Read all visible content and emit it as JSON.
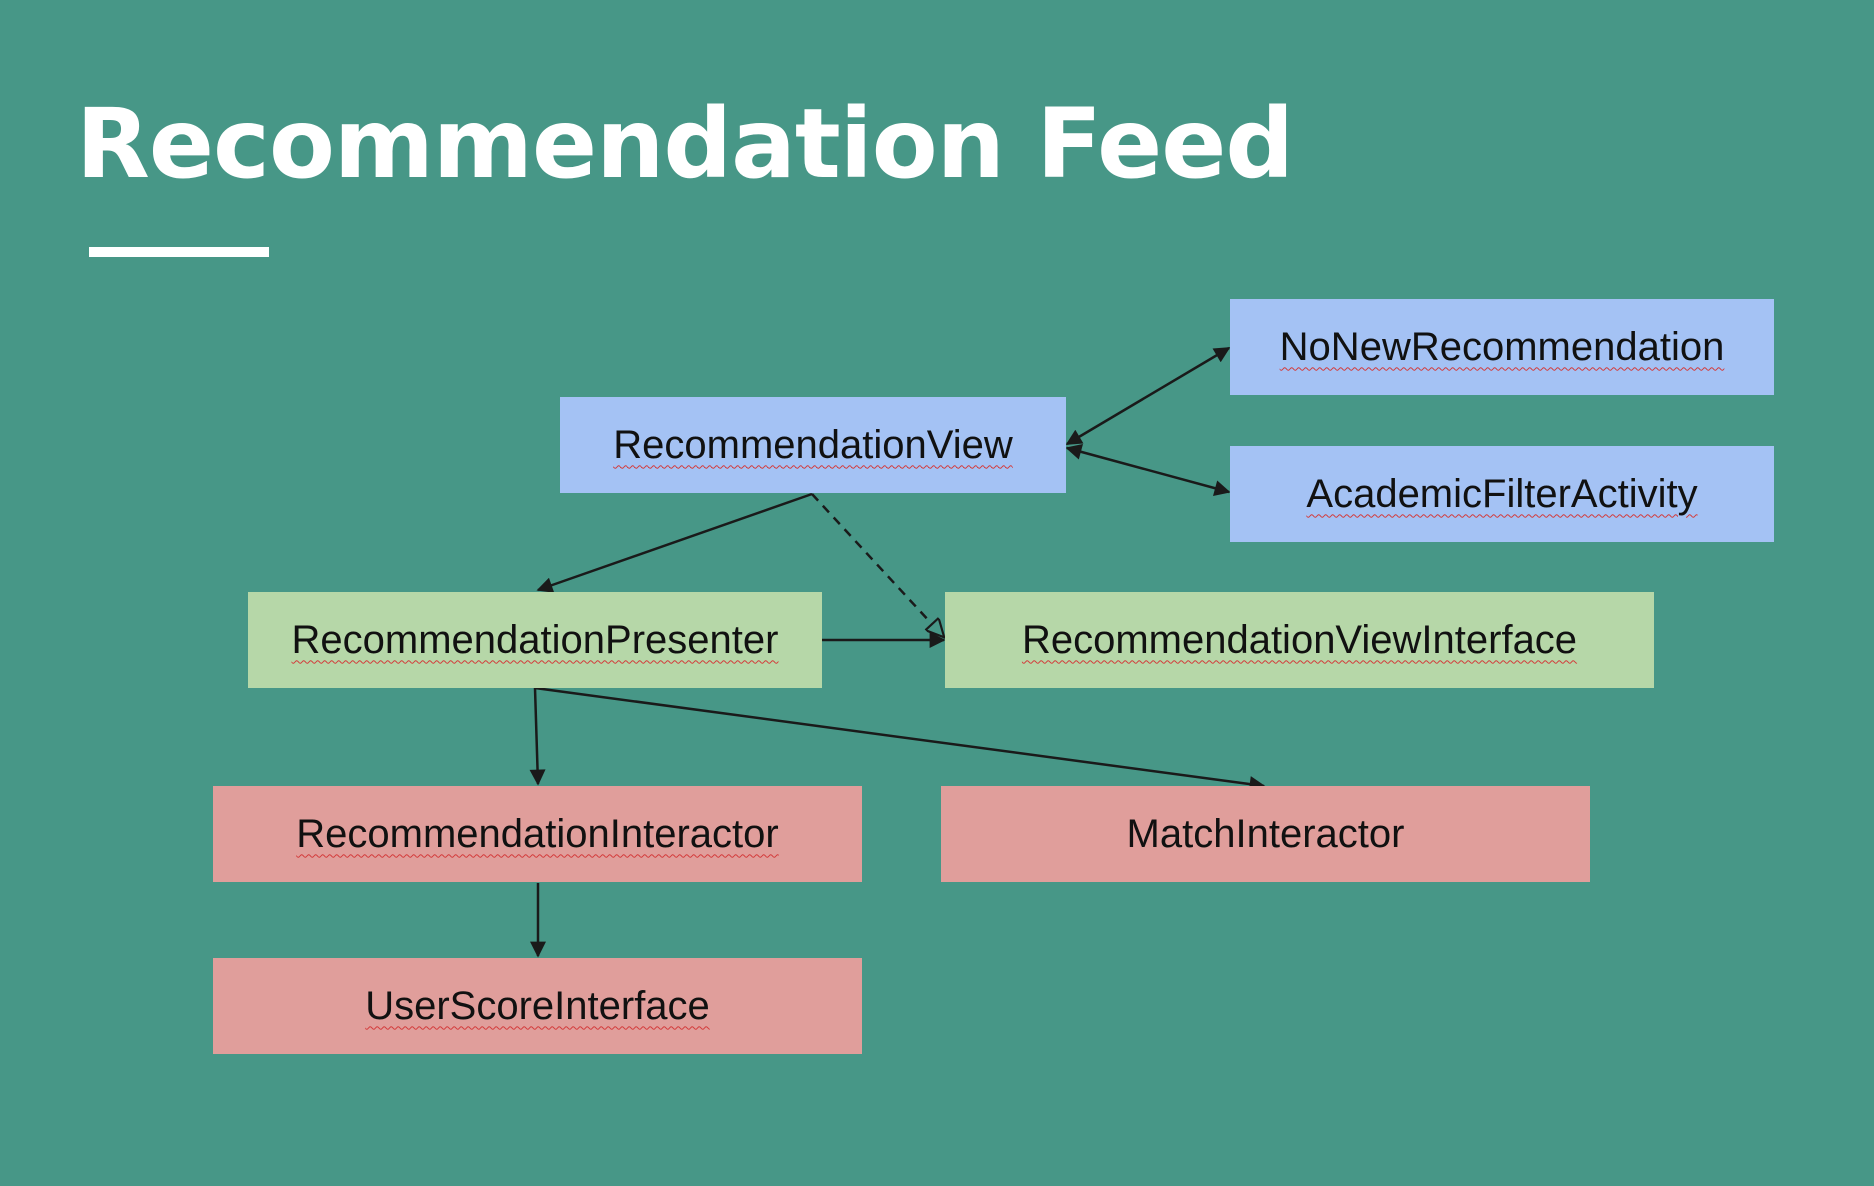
{
  "title": "Recommendation Feed",
  "colors": {
    "background": "#479787",
    "view_layer": "#a4c2f4",
    "presenter_layer": "#b6d7a8",
    "interactor_layer": "#e09e9b"
  },
  "nodes": {
    "recommendation_view": "RecommendationView",
    "no_new_recommendation": "NoNewRecommendation",
    "academic_filter_activity": "AcademicFilterActivity",
    "recommendation_presenter": "RecommendationPresenter",
    "recommendation_view_interface": "RecommendationViewInterface",
    "recommendation_interactor": "RecommendationInteractor",
    "match_interactor": "MatchInteractor",
    "user_score_interface": "UserScoreInterface"
  },
  "edges": [
    {
      "from": "RecommendationView",
      "to": "NoNewRecommendation",
      "style": "solid",
      "bidirectional": true
    },
    {
      "from": "RecommendationView",
      "to": "AcademicFilterActivity",
      "style": "solid",
      "bidirectional": true
    },
    {
      "from": "RecommendationView",
      "to": "RecommendationPresenter",
      "style": "solid"
    },
    {
      "from": "RecommendationView",
      "to": "RecommendationViewInterface",
      "style": "dashed",
      "head": "hollow"
    },
    {
      "from": "RecommendationPresenter",
      "to": "RecommendationViewInterface",
      "style": "solid"
    },
    {
      "from": "RecommendationPresenter",
      "to": "RecommendationInteractor",
      "style": "solid"
    },
    {
      "from": "RecommendationPresenter",
      "to": "MatchInteractor",
      "style": "solid"
    },
    {
      "from": "RecommendationInteractor",
      "to": "UserScoreInterface",
      "style": "solid"
    }
  ]
}
